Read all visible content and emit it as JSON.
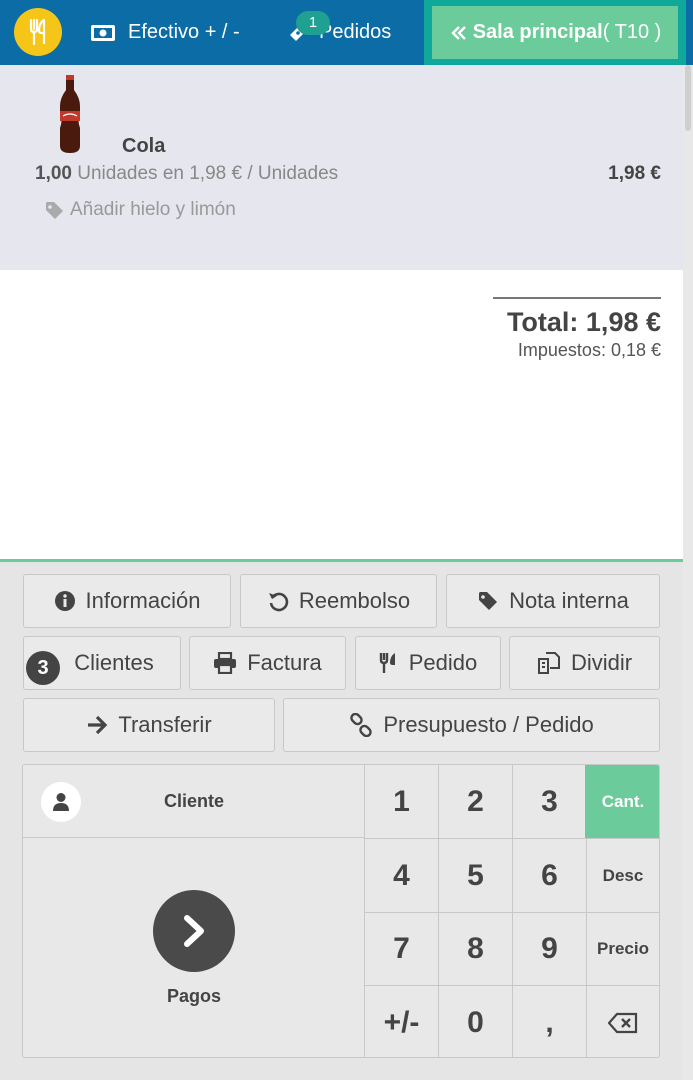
{
  "header": {
    "logo_icon": "utensils-icon",
    "cash_label": "Efectivo + / -",
    "orders_label": "Pedidos",
    "orders_badge": "1",
    "room_label": "Sala principal",
    "room_table": "( T10 )"
  },
  "order": {
    "lines": [
      {
        "product": "Cola",
        "qty": "1,00",
        "qty_detail": "Unidades en 1,98 € / Unidades",
        "price": "1,98 €",
        "note": "Añadir hielo y limón"
      }
    ],
    "total": "Total: 1,98 €",
    "taxes": "Impuestos: 0,18 €"
  },
  "controls": {
    "info": "Información",
    "refund": "Reembolso",
    "internal_note": "Nota interna",
    "customers_count": "3",
    "customers": "Clientes",
    "invoice": "Factura",
    "order": "Pedido",
    "split": "Dividir",
    "transfer": "Transferir",
    "quote": "Presupuesto / Pedido"
  },
  "pad": {
    "customer": "Cliente",
    "payments": "Pagos",
    "keys": [
      "1",
      "2",
      "3",
      "4",
      "5",
      "6",
      "7",
      "8",
      "9",
      "+/-",
      "0",
      ","
    ],
    "modes": [
      "Cant.",
      "Desc",
      "Precio"
    ],
    "active_mode": "Cant."
  },
  "colors": {
    "header_bg": "#0b6ca6",
    "accent_green": "#6ccb9a",
    "badge_teal": "#20a090",
    "logo_yellow": "#f5c518"
  }
}
